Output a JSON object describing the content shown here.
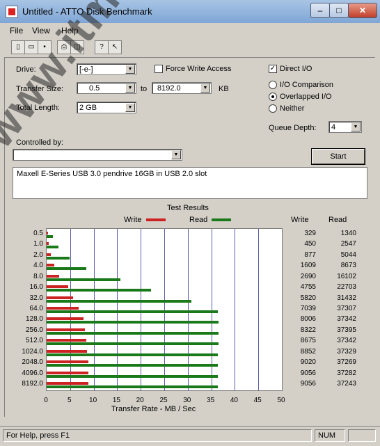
{
  "window": {
    "title": "Untitled - ATTO Disk Benchmark"
  },
  "menu": [
    "File",
    "View",
    "Help"
  ],
  "toolbar": [
    "new-icon",
    "open-icon",
    "save-icon",
    "print-icon",
    "print-preview-icon",
    "help-icon",
    "context-help-icon"
  ],
  "form": {
    "drive_label": "Drive:",
    "drive_value": "[-e-]",
    "force_write": "Force Write Access",
    "direct_io": "Direct I/O",
    "io_comparison": "I/O Comparison",
    "overlapped_io": "Overlapped I/O",
    "neither": "Neither",
    "queue_depth_label": "Queue Depth:",
    "queue_depth_value": "4",
    "transfer_label": "Transfer Size:",
    "transfer_from": "0.5",
    "transfer_to_label": "to",
    "transfer_to": "8192.0",
    "transfer_unit": "KB",
    "length_label": "Total Length:",
    "length_value": "2 GB",
    "controlled_label": "Controlled by:",
    "start_label": "Start",
    "description": "Maxell E-Series USB 3.0 pendrive 16GB in USB 2.0 slot"
  },
  "results": {
    "heading": "Test Results",
    "write_label": "Write",
    "read_label": "Read",
    "col_write": "Write",
    "col_read": "Read",
    "xlabel": "Transfer Rate - MB / Sec"
  },
  "chart_data": {
    "type": "bar",
    "categories": [
      "0.5",
      "1.0",
      "2.0",
      "4.0",
      "8.0",
      "16.0",
      "32.0",
      "64.0",
      "128.0",
      "256.0",
      "512.0",
      "1024.0",
      "2048.0",
      "4096.0",
      "8192.0"
    ],
    "series": [
      {
        "name": "Write",
        "color": "#cc2222",
        "values": [
          329,
          450,
          877,
          1609,
          2690,
          4755,
          5820,
          7039,
          8006,
          8322,
          8675,
          8852,
          9020,
          9056,
          9056
        ]
      },
      {
        "name": "Read",
        "color": "#1a7a1a",
        "values": [
          1340,
          2547,
          5044,
          8673,
          16102,
          22703,
          31432,
          37307,
          37342,
          37395,
          37342,
          37329,
          37269,
          37282,
          37243
        ]
      }
    ],
    "xlim": [
      0,
      50
    ],
    "xticks": [
      "0",
      "5",
      "10",
      "15",
      "20",
      "25",
      "30",
      "35",
      "40",
      "45",
      "50"
    ],
    "units": "KB/s"
  },
  "status": {
    "help": "For Help, press F1",
    "num": "NUM"
  },
  "watermark": "www.itmedia.sk"
}
